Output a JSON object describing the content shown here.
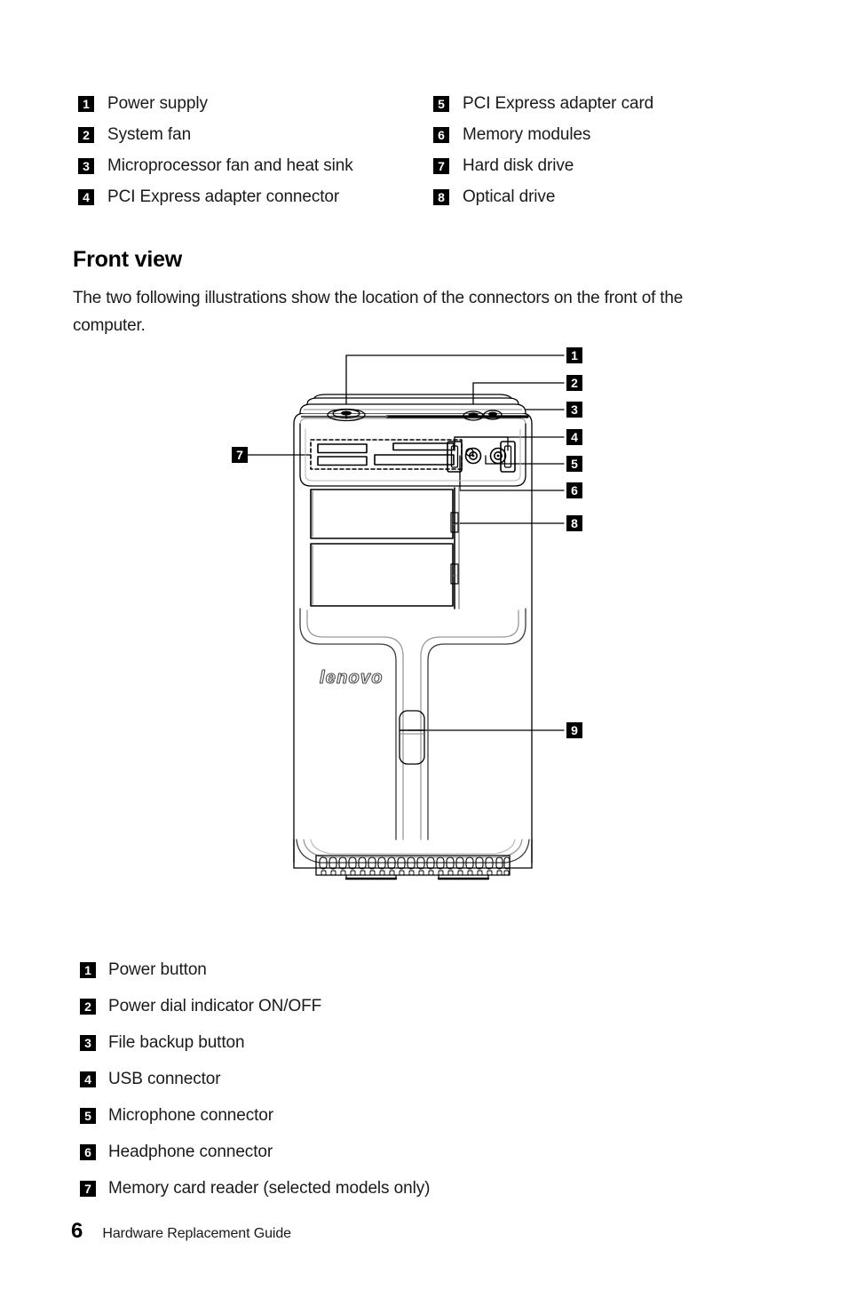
{
  "document": {
    "page_number": "6",
    "footer_title": "Hardware Replacement Guide"
  },
  "internal_components_legend": {
    "left_column": [
      {
        "number": "1",
        "label": "Power supply"
      },
      {
        "number": "2",
        "label": "System fan"
      },
      {
        "number": "3",
        "label": "Microprocessor fan and heat sink"
      },
      {
        "number": "4",
        "label": "PCI Express adapter connector"
      }
    ],
    "right_column": [
      {
        "number": "5",
        "label": "PCI Express adapter card"
      },
      {
        "number": "6",
        "label": "Memory modules"
      },
      {
        "number": "7",
        "label": "Hard disk drive"
      },
      {
        "number": "8",
        "label": "Optical drive"
      }
    ]
  },
  "section": {
    "heading": "Front view",
    "paragraph": "The two following illustrations show the location of the connectors on the front of the computer."
  },
  "illustration": {
    "brand_logo": "lenovo",
    "callouts": [
      {
        "number": "1",
        "target": "power-button"
      },
      {
        "number": "2",
        "target": "power-dial-indicator"
      },
      {
        "number": "3",
        "target": "file-backup-button"
      },
      {
        "number": "4",
        "target": "usb-connectors"
      },
      {
        "number": "5",
        "target": "microphone-connector"
      },
      {
        "number": "6",
        "target": "headphone-connector"
      },
      {
        "number": "7",
        "target": "memory-card-reader"
      },
      {
        "number": "8",
        "target": "optical-drive"
      },
      {
        "number": "9",
        "target": "front-panel-latch"
      }
    ]
  },
  "front_connectors_legend": [
    {
      "number": "1",
      "label": "Power button"
    },
    {
      "number": "2",
      "label": "Power dial indicator ON/OFF"
    },
    {
      "number": "3",
      "label": "File backup button"
    },
    {
      "number": "4",
      "label": "USB connector"
    },
    {
      "number": "5",
      "label": "Microphone connector"
    },
    {
      "number": "6",
      "label": "Headphone connector"
    },
    {
      "number": "7",
      "label": "Memory card reader (selected models only)"
    }
  ],
  "colors": {
    "badge_background": "#000000",
    "badge_text": "#ffffff",
    "body_text": "#1a1a1a",
    "line_art": "#000000"
  }
}
